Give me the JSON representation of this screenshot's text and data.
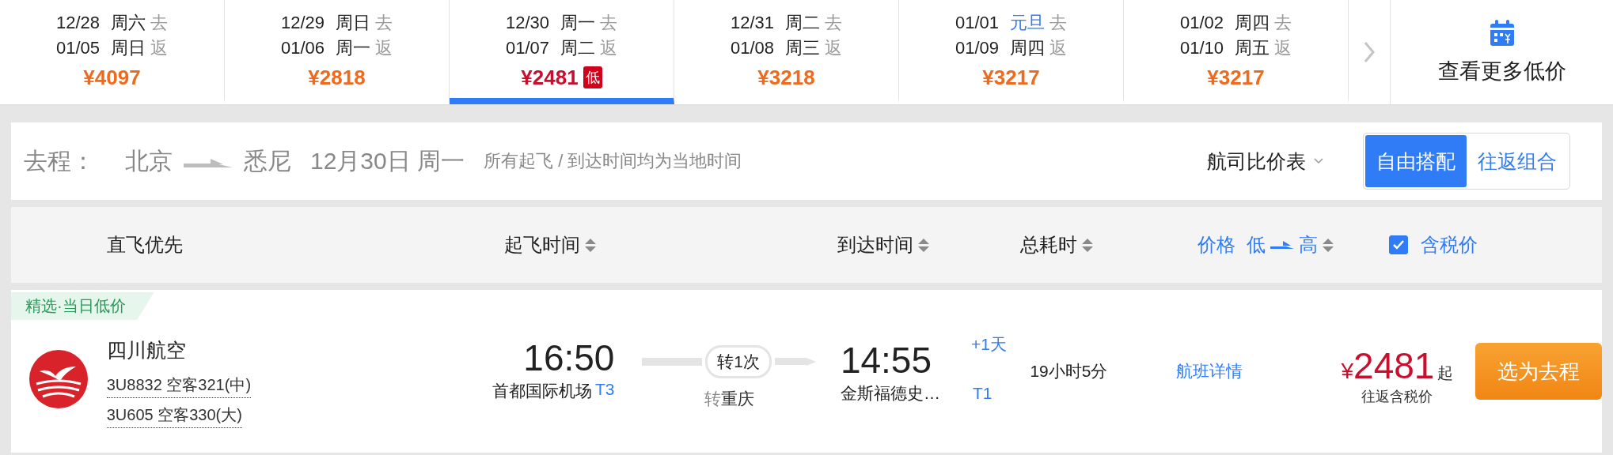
{
  "date_tabs": [
    {
      "depart_date": "12/28",
      "depart_day": "周六",
      "depart_label": "去",
      "return_date": "01/05",
      "return_day": "周日",
      "return_label": "返",
      "price": "¥4097",
      "holiday": false,
      "lowest": false,
      "selected": false
    },
    {
      "depart_date": "12/29",
      "depart_day": "周日",
      "depart_label": "去",
      "return_date": "01/06",
      "return_day": "周一",
      "return_label": "返",
      "price": "¥2818",
      "holiday": false,
      "lowest": false,
      "selected": false
    },
    {
      "depart_date": "12/30",
      "depart_day": "周一",
      "depart_label": "去",
      "return_date": "01/07",
      "return_day": "周二",
      "return_label": "返",
      "price": "¥2481",
      "badge": "低",
      "holiday": false,
      "lowest": true,
      "selected": true
    },
    {
      "depart_date": "12/31",
      "depart_day": "周二",
      "depart_label": "去",
      "return_date": "01/08",
      "return_day": "周三",
      "return_label": "返",
      "price": "¥3218",
      "holiday": false,
      "lowest": false,
      "selected": false
    },
    {
      "depart_date": "01/01",
      "depart_day": "元旦",
      "depart_label": "去",
      "return_date": "01/09",
      "return_day": "周四",
      "return_label": "返",
      "price": "¥3217",
      "holiday": true,
      "lowest": false,
      "selected": false
    },
    {
      "depart_date": "01/02",
      "depart_day": "周四",
      "depart_label": "去",
      "return_date": "01/10",
      "return_day": "周五",
      "return_label": "返",
      "price": "¥3217",
      "holiday": false,
      "lowest": false,
      "selected": false
    }
  ],
  "more_prices": {
    "label": "查看更多低价"
  },
  "route": {
    "label": "去程：",
    "from": "北京",
    "to": "悉尼",
    "date": "12月30日 周一",
    "note": "所有起飞 / 到达时间均为当地时间",
    "airline_table": "航司比价表",
    "modes": [
      {
        "label": "自由搭配",
        "selected": true
      },
      {
        "label": "往返组合",
        "selected": false
      }
    ]
  },
  "sort_header": {
    "columns": [
      {
        "kind": "plain",
        "label": "直飞优先"
      },
      {
        "kind": "sort",
        "label": "起飞时间"
      },
      {
        "kind": "sort",
        "label": "到达时间"
      },
      {
        "kind": "sort",
        "label": "总耗时"
      },
      {
        "kind": "price",
        "label": "价格",
        "low": "低",
        "high": "高"
      }
    ],
    "tax": {
      "label": "含税价",
      "checked": true
    }
  },
  "flights": [
    {
      "tag": "精选·当日低价",
      "airline": "四川航空",
      "segments": [
        "3U8832 空客321(中)",
        "3U605 空客330(大)"
      ],
      "depart_time": "16:50",
      "depart_airport": "首都国际机场",
      "depart_terminal": "T3",
      "stops": "转1次",
      "transfer_label": "转",
      "transfer_city": "重庆",
      "arrive_time": "14:55",
      "day_offset": "+1天",
      "arrive_airport": "金斯福德史…",
      "arrive_terminal": "T1",
      "duration": "19小时5分",
      "details": "航班详情",
      "currency": "¥",
      "price": "2481",
      "price_suffix": "起",
      "price_note": "往返含税价",
      "button": "选为去程"
    }
  ]
}
